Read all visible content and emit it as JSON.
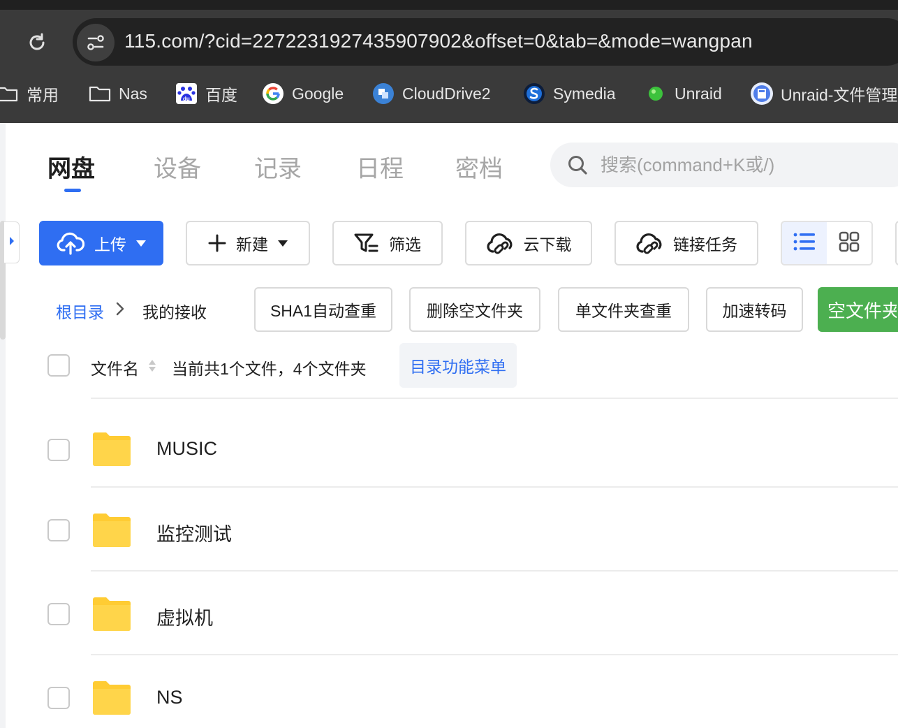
{
  "browser": {
    "url": "115.com/?cid=2272231927435907902&offset=0&tab=&mode=wangpan",
    "bookmarks": [
      {
        "label": "常用",
        "icon": "folder-icon"
      },
      {
        "label": "Nas",
        "icon": "folder-icon"
      },
      {
        "label": "百度",
        "icon": "baidu-icon"
      },
      {
        "label": "Google",
        "icon": "google-icon"
      },
      {
        "label": "CloudDrive2",
        "icon": "clouddrive-icon"
      },
      {
        "label": "Symedia",
        "icon": "symedia-icon"
      },
      {
        "label": "Unraid",
        "icon": "green-dot-icon"
      },
      {
        "label": "Unraid-文件管理",
        "icon": "unraid-file-icon"
      }
    ]
  },
  "nav": {
    "tabs": [
      {
        "label": "网盘",
        "active": true
      },
      {
        "label": "设备",
        "active": false
      },
      {
        "label": "记录",
        "active": false
      },
      {
        "label": "日程",
        "active": false
      },
      {
        "label": "密档",
        "active": false
      }
    ],
    "search_placeholder": "搜索(command+K或/)"
  },
  "toolbar": {
    "upload": "上传",
    "new": "新建",
    "filter": "筛选",
    "cloud_download": "云下载",
    "link_task": "链接任务",
    "view_modes": [
      "list-view-icon",
      "grid-view-icon"
    ],
    "active_view": "list"
  },
  "breadcrumb": {
    "root": "根目录",
    "current": "我的接收"
  },
  "tools": {
    "sha1": "SHA1自动查重",
    "delete_empty": "删除空文件夹",
    "single_dedupe": "单文件夹查重",
    "transcode": "加速转码",
    "empty_folder": "空文件夹"
  },
  "list": {
    "header_name": "文件名",
    "count_text": "当前共1个文件，4个文件夹",
    "dir_menu": "目录功能菜单",
    "items": [
      {
        "name": "MUSIC",
        "type": "folder"
      },
      {
        "name": "监控测试",
        "type": "folder"
      },
      {
        "name": "虚拟机",
        "type": "folder"
      },
      {
        "name": "NS",
        "type": "folder"
      }
    ]
  },
  "colors": {
    "accent": "#2f6ef2",
    "folder": "#ffcc33",
    "green": "#4caf50",
    "chrome": "#3a3a3a"
  }
}
